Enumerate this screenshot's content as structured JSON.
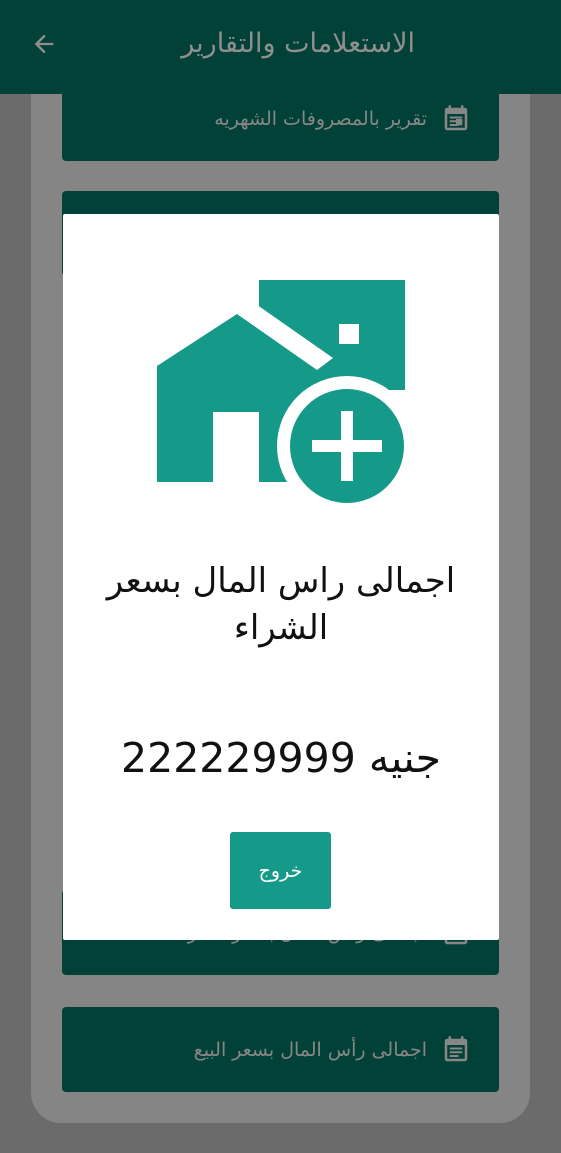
{
  "appbar": {
    "title": "الاستعلامات والتقارير",
    "back_icon": "arrow-back-icon"
  },
  "cards": [
    {
      "label": "تقرير بالمصروفات الشهريه",
      "icon": "calendar-icon"
    },
    {
      "label": "اجمالى راس المال بسعر الشراء",
      "icon": "calendar-icon"
    },
    {
      "label": "اجمالى رأس المال بسعر البيع",
      "icon": "calendar-icon"
    }
  ],
  "dialog": {
    "illustration": "home-add-icon",
    "title": "اجمالى راس المال بسعر الشراء",
    "amount_value": "222229999",
    "amount_unit": "جنيه",
    "exit_label": "خروج"
  },
  "colors": {
    "appbar": "#024137",
    "card": "#024137",
    "accent": "#159a8a",
    "scrim": "#6b6b6b"
  }
}
